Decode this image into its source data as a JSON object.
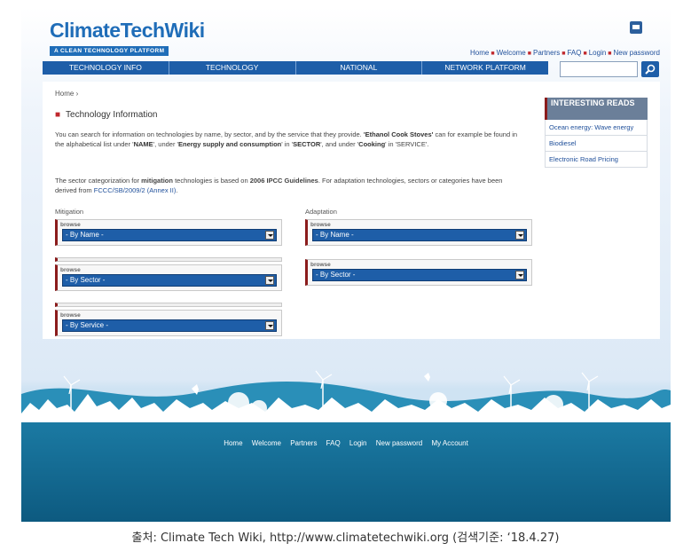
{
  "logo": {
    "main": "ClimateTechWiki",
    "tagline": "A CLEAN TECHNOLOGY PLATFORM"
  },
  "toplinks": [
    "Home",
    "Welcome",
    "Partners",
    "FAQ",
    "Login",
    "New password"
  ],
  "nav": [
    "TECHNOLOGY INFO",
    "TECHNOLOGY",
    "NATIONAL",
    "NETWORK PLATFORM"
  ],
  "search": {
    "placeholder": ""
  },
  "breadcrumb": "Home ›",
  "section_title": "Technology Information",
  "intro": {
    "p1_a": "You can search for information on technologies by name, by sector, and by the service that they provide. ",
    "p1_b": "'Ethanol Cook Stoves'",
    "p1_c": " can for example be found in the alphabetical list under '",
    "p1_d": "NAME",
    "p1_e": "', under '",
    "p1_f": "Energy supply and consumption",
    "p1_g": "' in '",
    "p1_h": "SECTOR",
    "p1_i": "', and under '",
    "p1_j": "Cooking",
    "p1_k": "' in 'SERVICE'.",
    "p2_a": "The sector categorization for ",
    "p2_b": "mitigation",
    "p2_c": " technologies is based on ",
    "p2_d": "2006 IPCC Guidelines",
    "p2_e": ". For adaptation technologies, sectors or categories have been derived from ",
    "p2_f": "FCCC/SB/2009/2 (Annex II)",
    "p2_g": "."
  },
  "mitigation": {
    "label": "Mitigation",
    "boxes": [
      {
        "browse": "browse",
        "select": "- By Name -"
      },
      {
        "browse": "browse",
        "select": "- By Sector -"
      },
      {
        "browse": "browse",
        "select": "- By Service -"
      }
    ]
  },
  "adaptation": {
    "label": "Adaptation",
    "boxes": [
      {
        "browse": "browse",
        "select": "- By Name -"
      },
      {
        "browse": "browse",
        "select": "- By Sector -"
      }
    ]
  },
  "sidebar": {
    "title": "INTERESTING READS",
    "items": [
      "Ocean energy: Wave energy",
      "Biodiesel",
      "Electronic Road Pricing"
    ]
  },
  "footer_links": [
    "Home",
    "Welcome",
    "Partners",
    "FAQ",
    "Login",
    "New password",
    "My Account"
  ],
  "caption": "출처: Climate Tech Wiki, http://www.climatetechwiki.org (검색기준: ‘18.4.27)",
  "colors": {
    "brand": "#1f6db8",
    "nav": "#1e5ea8",
    "accent": "#c0282d",
    "sea": "#14688f"
  }
}
